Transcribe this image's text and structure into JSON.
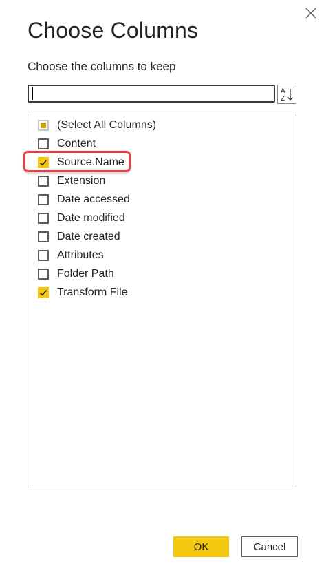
{
  "dialog": {
    "title": "Choose Columns",
    "subtitle": "Choose the columns to keep",
    "close_icon": "close-icon"
  },
  "search": {
    "value": "",
    "placeholder": "",
    "sort_icon": "sort-az-icon"
  },
  "columns": [
    {
      "label": "(Select All Columns)",
      "state": "partial"
    },
    {
      "label": "Content",
      "state": "unchecked"
    },
    {
      "label": "Source.Name",
      "state": "checked",
      "highlighted": true
    },
    {
      "label": "Extension",
      "state": "unchecked"
    },
    {
      "label": "Date accessed",
      "state": "unchecked"
    },
    {
      "label": "Date modified",
      "state": "unchecked"
    },
    {
      "label": "Date created",
      "state": "unchecked"
    },
    {
      "label": "Attributes",
      "state": "unchecked"
    },
    {
      "label": "Folder Path",
      "state": "unchecked"
    },
    {
      "label": "Transform File",
      "state": "checked"
    }
  ],
  "buttons": {
    "ok_label": "OK",
    "cancel_label": "Cancel"
  },
  "colors": {
    "accent": "#f2c811",
    "highlight": "#e8403f",
    "text": "#252423"
  }
}
